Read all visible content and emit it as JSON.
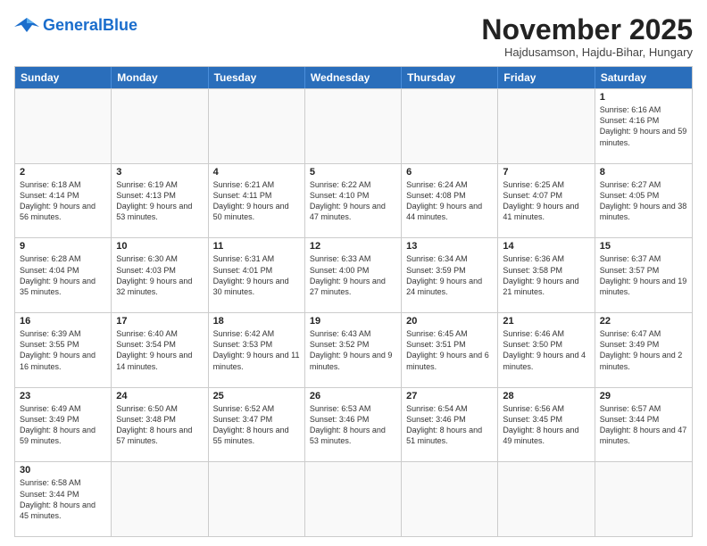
{
  "header": {
    "logo_general": "General",
    "logo_blue": "Blue",
    "month_title": "November 2025",
    "location": "Hajdusamson, Hajdu-Bihar, Hungary"
  },
  "days_of_week": [
    "Sunday",
    "Monday",
    "Tuesday",
    "Wednesday",
    "Thursday",
    "Friday",
    "Saturday"
  ],
  "weeks": [
    [
      {
        "day": "",
        "info": ""
      },
      {
        "day": "",
        "info": ""
      },
      {
        "day": "",
        "info": ""
      },
      {
        "day": "",
        "info": ""
      },
      {
        "day": "",
        "info": ""
      },
      {
        "day": "",
        "info": ""
      },
      {
        "day": "1",
        "info": "Sunrise: 6:16 AM\nSunset: 4:16 PM\nDaylight: 9 hours\nand 59 minutes."
      }
    ],
    [
      {
        "day": "2",
        "info": "Sunrise: 6:18 AM\nSunset: 4:14 PM\nDaylight: 9 hours\nand 56 minutes."
      },
      {
        "day": "3",
        "info": "Sunrise: 6:19 AM\nSunset: 4:13 PM\nDaylight: 9 hours\nand 53 minutes."
      },
      {
        "day": "4",
        "info": "Sunrise: 6:21 AM\nSunset: 4:11 PM\nDaylight: 9 hours\nand 50 minutes."
      },
      {
        "day": "5",
        "info": "Sunrise: 6:22 AM\nSunset: 4:10 PM\nDaylight: 9 hours\nand 47 minutes."
      },
      {
        "day": "6",
        "info": "Sunrise: 6:24 AM\nSunset: 4:08 PM\nDaylight: 9 hours\nand 44 minutes."
      },
      {
        "day": "7",
        "info": "Sunrise: 6:25 AM\nSunset: 4:07 PM\nDaylight: 9 hours\nand 41 minutes."
      },
      {
        "day": "8",
        "info": "Sunrise: 6:27 AM\nSunset: 4:05 PM\nDaylight: 9 hours\nand 38 minutes."
      }
    ],
    [
      {
        "day": "9",
        "info": "Sunrise: 6:28 AM\nSunset: 4:04 PM\nDaylight: 9 hours\nand 35 minutes."
      },
      {
        "day": "10",
        "info": "Sunrise: 6:30 AM\nSunset: 4:03 PM\nDaylight: 9 hours\nand 32 minutes."
      },
      {
        "day": "11",
        "info": "Sunrise: 6:31 AM\nSunset: 4:01 PM\nDaylight: 9 hours\nand 30 minutes."
      },
      {
        "day": "12",
        "info": "Sunrise: 6:33 AM\nSunset: 4:00 PM\nDaylight: 9 hours\nand 27 minutes."
      },
      {
        "day": "13",
        "info": "Sunrise: 6:34 AM\nSunset: 3:59 PM\nDaylight: 9 hours\nand 24 minutes."
      },
      {
        "day": "14",
        "info": "Sunrise: 6:36 AM\nSunset: 3:58 PM\nDaylight: 9 hours\nand 21 minutes."
      },
      {
        "day": "15",
        "info": "Sunrise: 6:37 AM\nSunset: 3:57 PM\nDaylight: 9 hours\nand 19 minutes."
      }
    ],
    [
      {
        "day": "16",
        "info": "Sunrise: 6:39 AM\nSunset: 3:55 PM\nDaylight: 9 hours\nand 16 minutes."
      },
      {
        "day": "17",
        "info": "Sunrise: 6:40 AM\nSunset: 3:54 PM\nDaylight: 9 hours\nand 14 minutes."
      },
      {
        "day": "18",
        "info": "Sunrise: 6:42 AM\nSunset: 3:53 PM\nDaylight: 9 hours\nand 11 minutes."
      },
      {
        "day": "19",
        "info": "Sunrise: 6:43 AM\nSunset: 3:52 PM\nDaylight: 9 hours\nand 9 minutes."
      },
      {
        "day": "20",
        "info": "Sunrise: 6:45 AM\nSunset: 3:51 PM\nDaylight: 9 hours\nand 6 minutes."
      },
      {
        "day": "21",
        "info": "Sunrise: 6:46 AM\nSunset: 3:50 PM\nDaylight: 9 hours\nand 4 minutes."
      },
      {
        "day": "22",
        "info": "Sunrise: 6:47 AM\nSunset: 3:49 PM\nDaylight: 9 hours\nand 2 minutes."
      }
    ],
    [
      {
        "day": "23",
        "info": "Sunrise: 6:49 AM\nSunset: 3:49 PM\nDaylight: 8 hours\nand 59 minutes."
      },
      {
        "day": "24",
        "info": "Sunrise: 6:50 AM\nSunset: 3:48 PM\nDaylight: 8 hours\nand 57 minutes."
      },
      {
        "day": "25",
        "info": "Sunrise: 6:52 AM\nSunset: 3:47 PM\nDaylight: 8 hours\nand 55 minutes."
      },
      {
        "day": "26",
        "info": "Sunrise: 6:53 AM\nSunset: 3:46 PM\nDaylight: 8 hours\nand 53 minutes."
      },
      {
        "day": "27",
        "info": "Sunrise: 6:54 AM\nSunset: 3:46 PM\nDaylight: 8 hours\nand 51 minutes."
      },
      {
        "day": "28",
        "info": "Sunrise: 6:56 AM\nSunset: 3:45 PM\nDaylight: 8 hours\nand 49 minutes."
      },
      {
        "day": "29",
        "info": "Sunrise: 6:57 AM\nSunset: 3:44 PM\nDaylight: 8 hours\nand 47 minutes."
      }
    ],
    [
      {
        "day": "30",
        "info": "Sunrise: 6:58 AM\nSunset: 3:44 PM\nDaylight: 8 hours\nand 45 minutes."
      },
      {
        "day": "",
        "info": ""
      },
      {
        "day": "",
        "info": ""
      },
      {
        "day": "",
        "info": ""
      },
      {
        "day": "",
        "info": ""
      },
      {
        "day": "",
        "info": ""
      },
      {
        "day": "",
        "info": ""
      }
    ]
  ]
}
